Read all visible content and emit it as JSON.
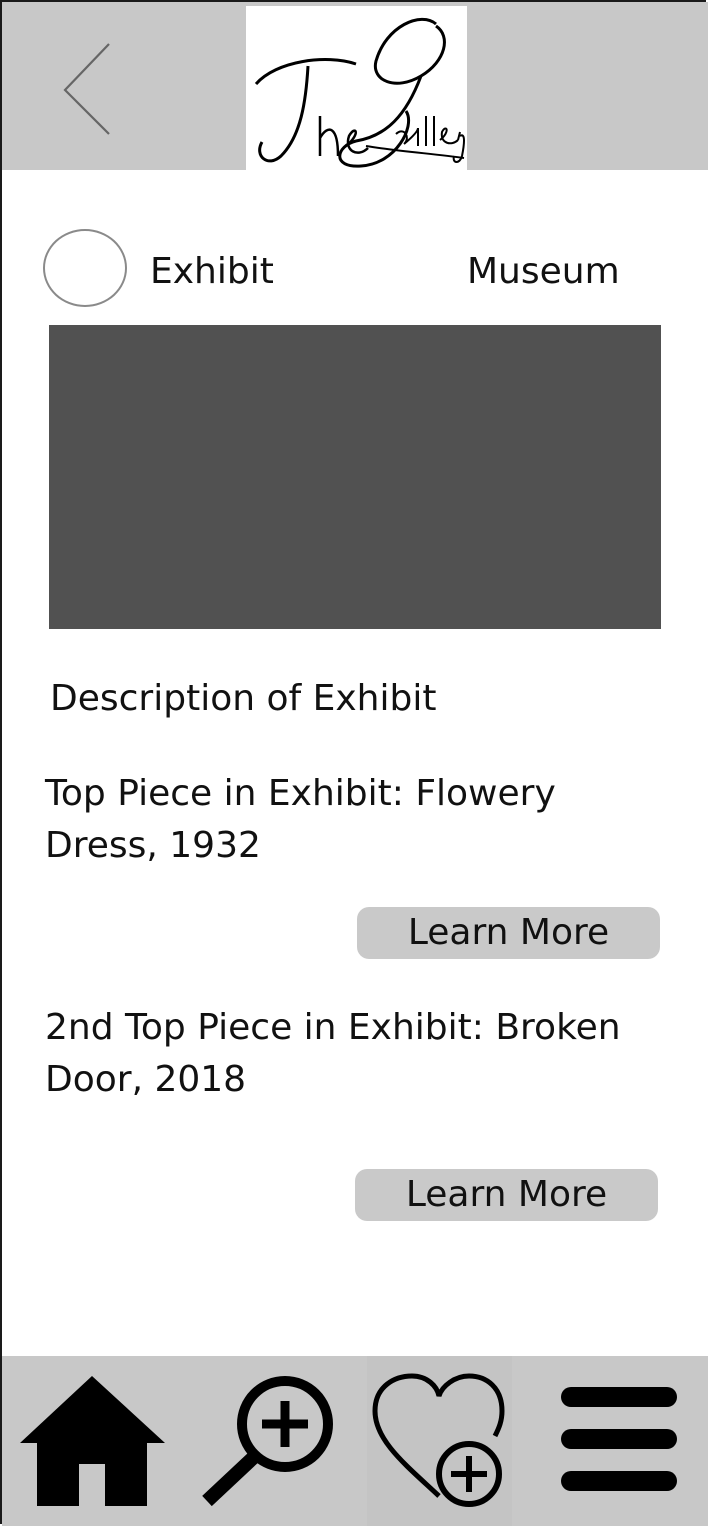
{
  "header": {
    "back_icon": "chevron-left-icon",
    "logo_text": "The Gallery"
  },
  "exhibit": {
    "title": "Exhibit",
    "museum_label": "Museum",
    "description": "Description of Exhibit",
    "pieces": [
      {
        "text": "Top Piece in Exhibit: Flowery Dress, 1932",
        "button_label": "Learn More"
      },
      {
        "text": "2nd Top Piece in Exhibit: Broken Door, 2018",
        "button_label": "Learn More"
      }
    ]
  },
  "nav": {
    "items": [
      {
        "icon": "home-icon"
      },
      {
        "icon": "zoom-in-search-icon"
      },
      {
        "icon": "heart-add-icon"
      },
      {
        "icon": "hamburger-menu-icon"
      }
    ]
  },
  "colors": {
    "bar_background": "#c8c8c8",
    "image_placeholder": "#515151",
    "button_background": "#c9c9c9"
  }
}
